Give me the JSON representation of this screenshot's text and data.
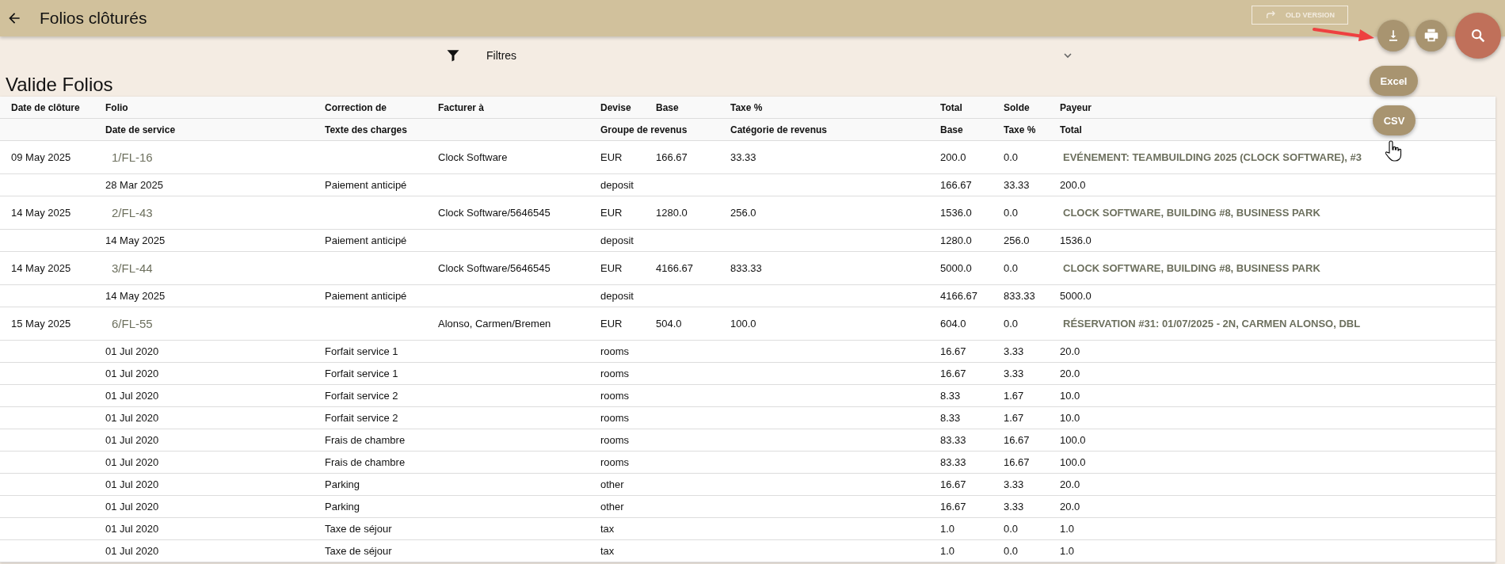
{
  "header": {
    "title": "Folios clôturés",
    "old_version": "OLD VERSION"
  },
  "filter": {
    "label": "Filtres"
  },
  "export_menu": [
    "Excel",
    "CSV"
  ],
  "section_title": "Valide Folios",
  "table": {
    "columns": {
      "closing_date": "Date de clôture",
      "folio": "Folio",
      "correction": "Correction de",
      "bill_to": "Facturer à",
      "currency": "Devise",
      "base": "Base",
      "tax": "Taxe %",
      "total": "Total",
      "balance": "Solde",
      "payer": "Payeur"
    },
    "subcolumns": {
      "service_date": "Date de service",
      "charge_text": "Texte des charges",
      "revenue_group": "Groupe de revenus",
      "revenue_category": "Catégorie de revenus",
      "base": "Base",
      "tax": "Taxe %",
      "total": "Total"
    },
    "rows": [
      {
        "kind": "folio",
        "closing_date": "09 May 2025",
        "folio": "1/FL-16",
        "bill_to": "Clock Software",
        "currency": "EUR",
        "base": "166.67",
        "tax": "33.33",
        "total": "200.0",
        "balance": "0.0",
        "payer": "EVÉNEMENT: TEAMBUILDING 2025 (CLOCK SOFTWARE), #3"
      },
      {
        "kind": "charge",
        "service_date": "28 Mar 2025",
        "charge_text": "Paiement anticipé",
        "revenue_group": "deposit",
        "base": "166.67",
        "tax": "33.33",
        "total": "200.0"
      },
      {
        "kind": "folio",
        "closing_date": "14 May 2025",
        "folio": "2/FL-43",
        "bill_to": "Clock Software/5646545",
        "currency": "EUR",
        "base": "1280.0",
        "tax": "256.0",
        "total": "1536.0",
        "balance": "0.0",
        "payer": "CLOCK SOFTWARE, BUILDING #8, BUSINESS PARK"
      },
      {
        "kind": "charge",
        "service_date": "14 May 2025",
        "charge_text": "Paiement anticipé",
        "revenue_group": "deposit",
        "base": "1280.0",
        "tax": "256.0",
        "total": "1536.0"
      },
      {
        "kind": "folio",
        "closing_date": "14 May 2025",
        "folio": "3/FL-44",
        "bill_to": "Clock Software/5646545",
        "currency": "EUR",
        "base": "4166.67",
        "tax": "833.33",
        "total": "5000.0",
        "balance": "0.0",
        "payer": "CLOCK SOFTWARE, BUILDING #8, BUSINESS PARK"
      },
      {
        "kind": "charge",
        "service_date": "14 May 2025",
        "charge_text": "Paiement anticipé",
        "revenue_group": "deposit",
        "base": "4166.67",
        "tax": "833.33",
        "total": "5000.0"
      },
      {
        "kind": "folio",
        "closing_date": "15 May 2025",
        "folio": "6/FL-55",
        "bill_to": "Alonso, Carmen/Bremen",
        "currency": "EUR",
        "base": "504.0",
        "tax": "100.0",
        "total": "604.0",
        "balance": "0.0",
        "payer": "RÉSERVATION #31: 01/07/2025 - 2N, CARMEN ALONSO, DBL"
      },
      {
        "kind": "charge",
        "service_date": "01 Jul 2020",
        "charge_text": "Forfait service 1",
        "revenue_group": "rooms",
        "base": "16.67",
        "tax": "3.33",
        "total": "20.0"
      },
      {
        "kind": "charge",
        "service_date": "01 Jul 2020",
        "charge_text": "Forfait service 1",
        "revenue_group": "rooms",
        "base": "16.67",
        "tax": "3.33",
        "total": "20.0"
      },
      {
        "kind": "charge",
        "service_date": "01 Jul 2020",
        "charge_text": "Forfait service 2",
        "revenue_group": "rooms",
        "base": "8.33",
        "tax": "1.67",
        "total": "10.0"
      },
      {
        "kind": "charge",
        "service_date": "01 Jul 2020",
        "charge_text": "Forfait service 2",
        "revenue_group": "rooms",
        "base": "8.33",
        "tax": "1.67",
        "total": "10.0"
      },
      {
        "kind": "charge",
        "service_date": "01 Jul 2020",
        "charge_text": "Frais de chambre",
        "revenue_group": "rooms",
        "base": "83.33",
        "tax": "16.67",
        "total": "100.0"
      },
      {
        "kind": "charge",
        "service_date": "01 Jul 2020",
        "charge_text": "Frais de chambre",
        "revenue_group": "rooms",
        "base": "83.33",
        "tax": "16.67",
        "total": "100.0"
      },
      {
        "kind": "charge",
        "service_date": "01 Jul 2020",
        "charge_text": "Parking",
        "revenue_group": "other",
        "base": "16.67",
        "tax": "3.33",
        "total": "20.0"
      },
      {
        "kind": "charge",
        "service_date": "01 Jul 2020",
        "charge_text": "Parking",
        "revenue_group": "other",
        "base": "16.67",
        "tax": "3.33",
        "total": "20.0"
      },
      {
        "kind": "charge",
        "service_date": "01 Jul 2020",
        "charge_text": "Taxe de séjour",
        "revenue_group": "tax",
        "base": "1.0",
        "tax": "0.0",
        "total": "1.0"
      },
      {
        "kind": "charge",
        "service_date": "01 Jul 2020",
        "charge_text": "Taxe de séjour",
        "revenue_group": "tax",
        "base": "1.0",
        "tax": "0.0",
        "total": "1.0"
      }
    ]
  }
}
